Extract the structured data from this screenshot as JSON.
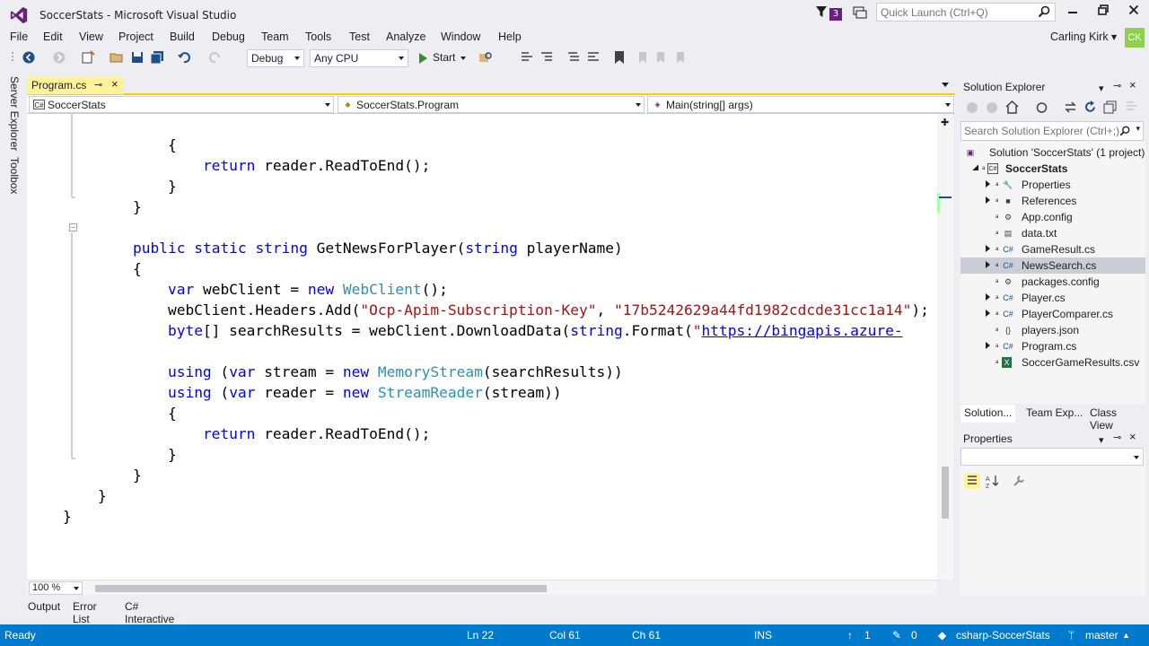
{
  "window": {
    "title": "SoccerStats - Microsoft Visual Studio",
    "notification_count": "3",
    "quick_launch_placeholder": "Quick Launch (Ctrl+Q)"
  },
  "menu": [
    "File",
    "Edit",
    "View",
    "Project",
    "Build",
    "Debug",
    "Team",
    "Tools",
    "Test",
    "Analyze",
    "Window",
    "Help"
  ],
  "user": {
    "name": "Carling Kirk",
    "initials": "CK",
    "avatar_color": "#8fd14f"
  },
  "toolbar": {
    "configuration": "Debug",
    "platform": "Any CPU",
    "start_label": "Start"
  },
  "left_dock": {
    "server_explorer": "Server Explorer",
    "toolbox": "Toolbox"
  },
  "document": {
    "tab_label": "Program.cs",
    "nav_project": "SoccerStats",
    "nav_class": "SoccerStats.Program",
    "nav_member": "Main(string[] args)",
    "zoom": "100 %"
  },
  "code_lines": [
    "            {",
    "                return reader.ReadToEnd();",
    "            }",
    "        }",
    "",
    "        public static string GetNewsForPlayer(string playerName)",
    "        {",
    "            var webClient = new WebClient();",
    "            webClient.Headers.Add(\"Ocp-Apim-Subscription-Key\", \"17b5242629a44fd1982cdcde31cc1a14\");",
    "            byte[] searchResults = webClient.DownloadData(string.Format(\"https://bingapis.azure-",
    "",
    "            using (var stream = new MemoryStream(searchResults))",
    "            using (var reader = new StreamReader(stream))",
    "            {",
    "                return reader.ReadToEnd();",
    "            }",
    "        }",
    "    }",
    "}"
  ],
  "bottom_tabs": [
    "Output",
    "Error List",
    "C# Interactive"
  ],
  "solution_explorer": {
    "title": "Solution Explorer",
    "search_placeholder": "Search Solution Explorer (Ctrl+;)",
    "solution_label": "Solution 'SoccerStats' (1 project)",
    "project_label": "SoccerStats",
    "items": [
      {
        "label": "Properties",
        "icon": "wrench-icon",
        "expandable": true
      },
      {
        "label": "References",
        "icon": "references-icon",
        "expandable": true
      },
      {
        "label": "App.config",
        "icon": "config-file-icon",
        "expandable": false
      },
      {
        "label": "data.txt",
        "icon": "text-file-icon",
        "expandable": false
      },
      {
        "label": "GameResult.cs",
        "icon": "csharp-file-icon",
        "expandable": true
      },
      {
        "label": "NewsSearch.cs",
        "icon": "csharp-file-icon",
        "expandable": true,
        "selected": true
      },
      {
        "label": "packages.config",
        "icon": "config-file-icon",
        "expandable": false
      },
      {
        "label": "Player.cs",
        "icon": "csharp-file-icon",
        "expandable": true
      },
      {
        "label": "PlayerComparer.cs",
        "icon": "csharp-file-icon",
        "expandable": true
      },
      {
        "label": "players.json",
        "icon": "json-file-icon",
        "expandable": false
      },
      {
        "label": "Program.cs",
        "icon": "csharp-file-icon",
        "expandable": true
      },
      {
        "label": "SoccerGameResults.csv",
        "icon": "excel-file-icon",
        "expandable": false
      }
    ],
    "tabs": [
      "Solution...",
      "Team Exp...",
      "Class View"
    ]
  },
  "properties": {
    "title": "Properties"
  },
  "status": {
    "ready": "Ready",
    "line": "Ln 22",
    "col": "Col 61",
    "ch": "Ch 61",
    "mode": "INS",
    "up_count": "1",
    "pending_count": "0",
    "repo": "csharp-SoccerStats",
    "branch": "master",
    "bar_color": "#007acc"
  }
}
